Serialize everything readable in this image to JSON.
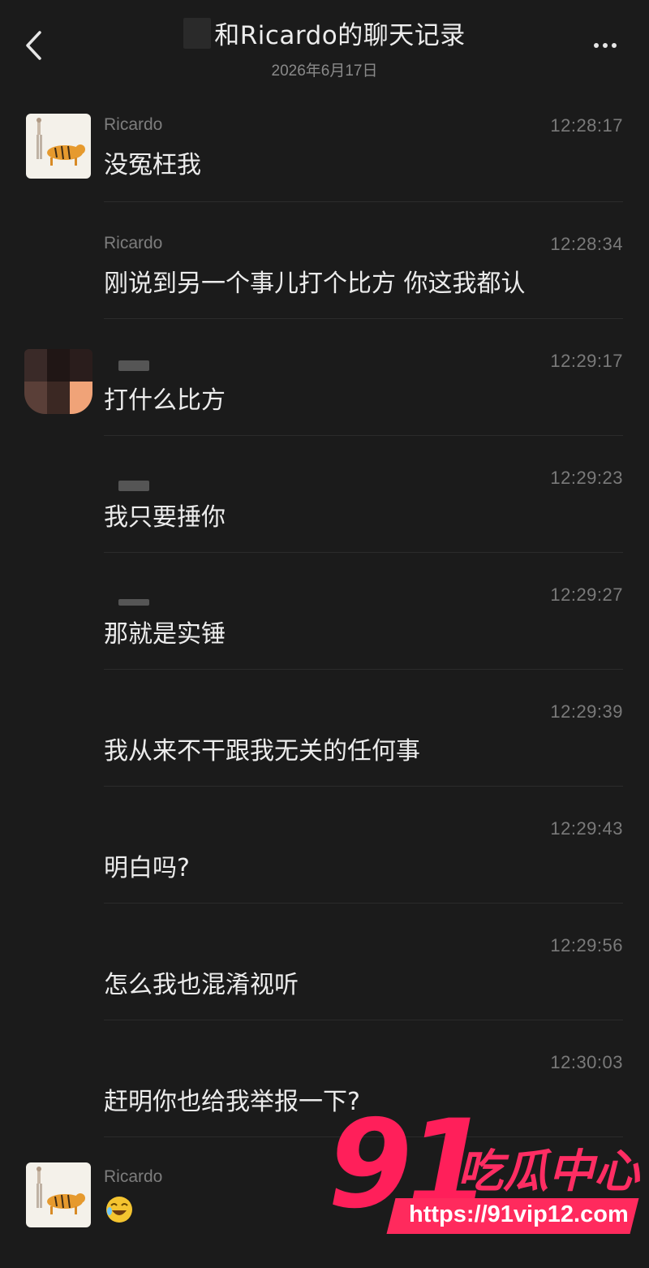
{
  "header": {
    "title": "和Ricardo的聊天记录",
    "subtitle": "2026年6月17日"
  },
  "colors": {
    "background": "#1b1b1b",
    "text_primary": "#ececec",
    "text_secondary": "#7d7d7d",
    "watermark": "#ff1f5a"
  },
  "messages": [
    {
      "sender": "Ricardo",
      "time": "12:28:17",
      "text": "没冤枉我",
      "avatar": "tiger-avatar"
    },
    {
      "sender": "Ricardo",
      "time": "12:28:34",
      "text": "刚说到另一个事儿打个比方 你这我都认",
      "avatar": ""
    },
    {
      "sender": "",
      "time": "12:29:17",
      "text": "打什么比方",
      "avatar": "blurred-avatar"
    },
    {
      "sender": "",
      "time": "12:29:23",
      "text": "我只要捶你",
      "avatar": ""
    },
    {
      "sender": "",
      "time": "12:29:27",
      "text": "那就是实锤",
      "avatar": ""
    },
    {
      "sender": "",
      "time": "12:29:39",
      "text": "我从来不干跟我无关的任何事",
      "avatar": ""
    },
    {
      "sender": "",
      "time": "12:29:43",
      "text": "明白吗?",
      "avatar": ""
    },
    {
      "sender": "",
      "time": "12:29:56",
      "text": "怎么我也混淆视听",
      "avatar": ""
    },
    {
      "sender": "",
      "time": "12:30:03",
      "text": "赶明你也给我举报一下?",
      "avatar": ""
    },
    {
      "sender": "Ricardo",
      "time": "",
      "text": "",
      "avatar": "tiger-avatar",
      "content_icon": "laughing-emoji-icon"
    }
  ],
  "watermark": {
    "number": "91",
    "name": "吃瓜中心",
    "url": "https://91vip12.com"
  }
}
